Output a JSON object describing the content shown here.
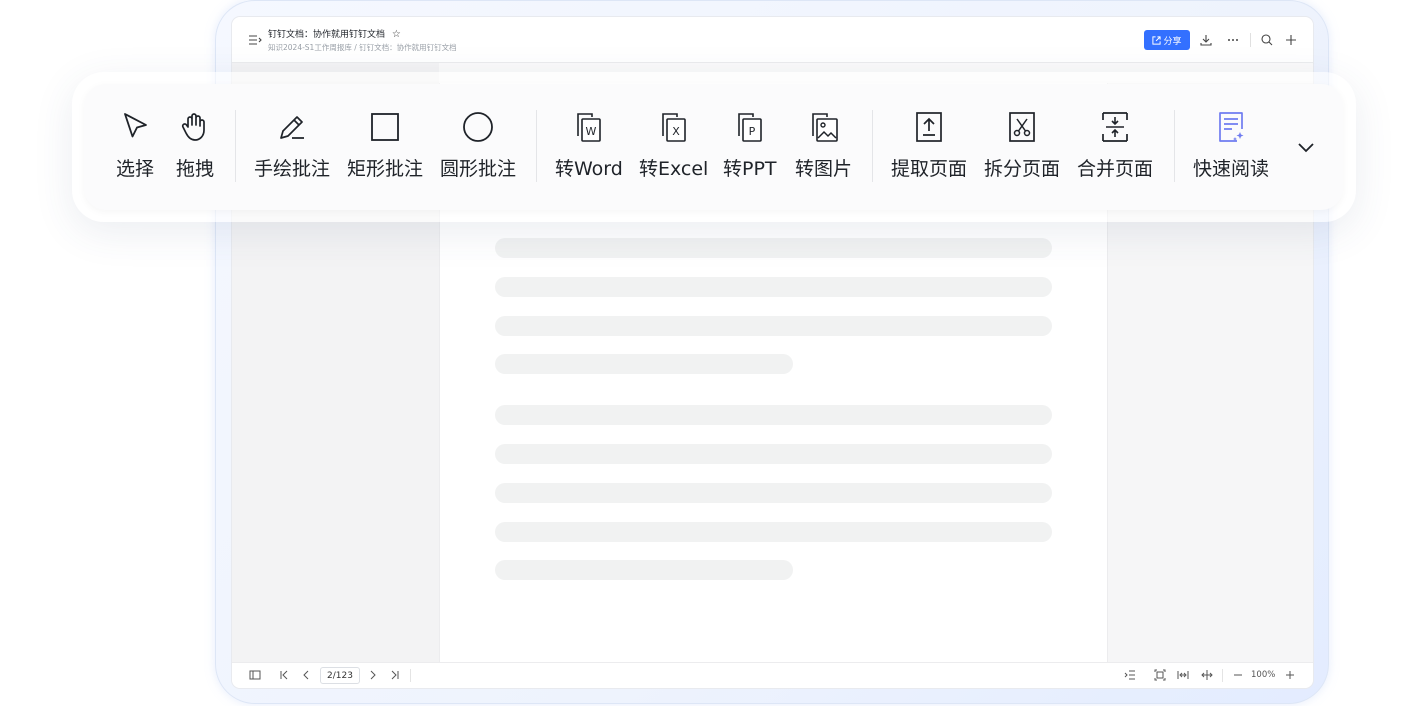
{
  "window": {
    "title": "钉钉文档：协作就用钉钉文档",
    "breadcrumb": "知识2024-S1工作周报库 / 钉钉文档：协作就用钉钉文档",
    "share_label": "分享"
  },
  "pager": {
    "current": "2/123",
    "zoom": "100%"
  },
  "toolbar": {
    "select": "选择",
    "drag": "拖拽",
    "freehand": "手绘批注",
    "rect": "矩形批注",
    "circle": "圆形批注",
    "to_word": "转Word",
    "to_excel": "转Excel",
    "to_ppt": "转PPT",
    "to_image": "转图片",
    "extract": "提取页面",
    "split": "拆分页面",
    "merge": "合并页面",
    "quick_read": "快速阅读"
  },
  "colors": {
    "accent": "#3370ff",
    "quick_read_icon": "#6f7cf0"
  },
  "icons": [
    "menu-icon",
    "star-icon",
    "external-link-icon",
    "download-icon",
    "more-icon",
    "search-icon",
    "plus-icon",
    "sidebar-toggle-icon",
    "first-page-icon",
    "prev-page-icon",
    "next-page-icon",
    "last-page-icon",
    "outline-icon",
    "fit-page-icon",
    "fit-width-icon",
    "fit-height-icon",
    "zoom-out-icon",
    "zoom-in-icon",
    "chevron-down-icon"
  ]
}
